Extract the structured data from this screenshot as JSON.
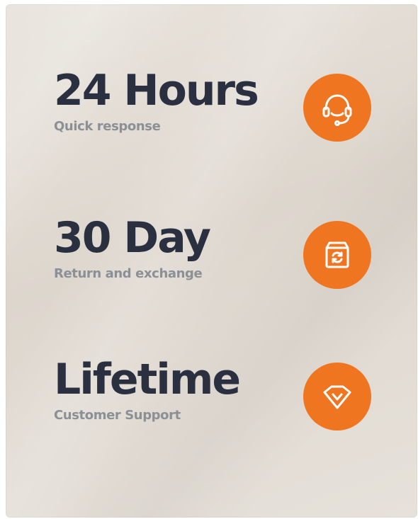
{
  "accent_color": "#f07521",
  "features": [
    {
      "title": "24 Hours",
      "subtitle": "Quick response",
      "icon": "headset-icon"
    },
    {
      "title": "30 Day",
      "subtitle": "Return and exchange",
      "icon": "box-refresh-icon"
    },
    {
      "title": "Lifetime",
      "subtitle": "Customer Support",
      "icon": "diamond-icon"
    }
  ]
}
